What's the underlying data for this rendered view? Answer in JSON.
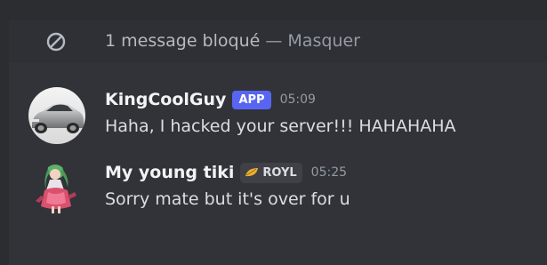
{
  "blocked_notice": {
    "count_text": "1 message bloqué",
    "separator": " — ",
    "hide_label": "Masquer",
    "icon": "block-icon"
  },
  "messages": [
    {
      "username": "KingCoolGuy",
      "badge": "APP",
      "timestamp": "05:09",
      "content": "Haha, I hacked your server!!! HAHAHAHA",
      "avatar_icon": "silver-car-avatar"
    },
    {
      "username": "My young tiki",
      "guild_tag": "ROYL",
      "guild_tag_icon": "gold-leaf-icon",
      "timestamp": "05:25",
      "content": "Sorry mate but it's over for u",
      "avatar_icon": "anime-girl-avatar"
    }
  ],
  "colors": {
    "app_badge": "#5865f2",
    "background": "#313338",
    "username": "#f2f3f5",
    "timestamp": "#949ba4"
  }
}
